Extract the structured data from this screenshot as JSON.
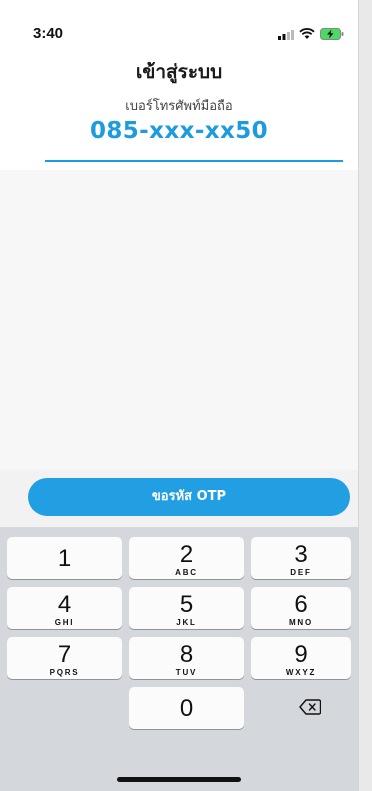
{
  "status_bar": {
    "time": "3:40",
    "icons": [
      "signal-icon",
      "wifi-icon",
      "battery-charging-icon"
    ],
    "battery_color": "#4cd964"
  },
  "title": "เข้าสู่ระบบ",
  "phone": {
    "label": "เบอร์โทรศัพท์มือถือ",
    "value": "085-xxx-xx50",
    "accent_color": "#1d9bdf"
  },
  "otp_button": {
    "label": "ขอรหัส OTP",
    "color": "#229fe2"
  },
  "keypad": {
    "keys": [
      {
        "digit": "1",
        "letters": ""
      },
      {
        "digit": "2",
        "letters": "ABC"
      },
      {
        "digit": "3",
        "letters": "DEF"
      },
      {
        "digit": "4",
        "letters": "GHI"
      },
      {
        "digit": "5",
        "letters": "JKL"
      },
      {
        "digit": "6",
        "letters": "MNO"
      },
      {
        "digit": "7",
        "letters": "PQRS"
      },
      {
        "digit": "8",
        "letters": "TUV"
      },
      {
        "digit": "9",
        "letters": "WXYZ"
      },
      {
        "digit": "0",
        "letters": ""
      }
    ],
    "backspace_icon": "backspace-icon"
  }
}
